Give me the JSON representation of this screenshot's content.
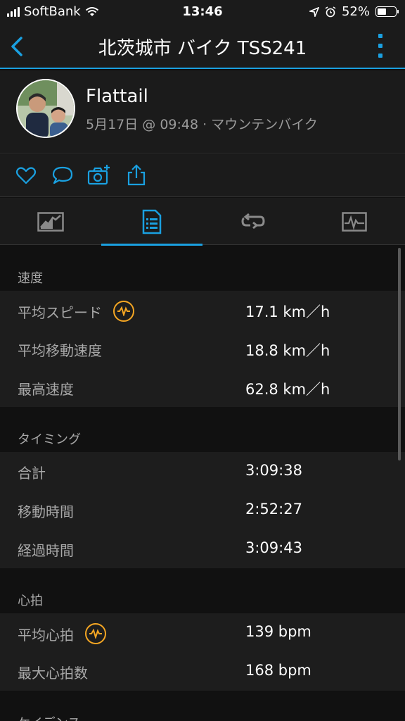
{
  "status_bar": {
    "carrier": "SoftBank",
    "time": "13:46",
    "battery_percent": "52%",
    "battery_level": 0.52
  },
  "navbar": {
    "title": "北茨城市 バイク TSS241",
    "accent_color": "#1aa0e0"
  },
  "profile": {
    "name": "Flattail",
    "meta": "5月17日 @ 09:48 · マウンテンバイク"
  },
  "actions": [
    "heart-icon",
    "comment-icon",
    "camera-add-icon",
    "share-icon"
  ],
  "tabs": [
    {
      "name": "overview-tab",
      "icon": "map-chart-icon",
      "active": false
    },
    {
      "name": "stats-tab",
      "icon": "document-list-icon",
      "active": true
    },
    {
      "name": "laps-tab",
      "icon": "loop-icon",
      "active": false
    },
    {
      "name": "charts-tab",
      "icon": "graph-icon",
      "active": false
    }
  ],
  "sections": {
    "speed": {
      "title": "速度",
      "rows": [
        {
          "label": "平均スピード",
          "value": "17.1 km／h",
          "badge": true
        },
        {
          "label": "平均移動速度",
          "value": "18.8 km／h",
          "badge": false
        },
        {
          "label": "最高速度",
          "value": "62.8 km／h",
          "badge": false
        }
      ]
    },
    "timing": {
      "title": "タイミング",
      "rows": [
        {
          "label": "合計",
          "value": "3:09:38",
          "badge": false
        },
        {
          "label": "移動時間",
          "value": "2:52:27",
          "badge": false
        },
        {
          "label": "経過時間",
          "value": "3:09:43",
          "badge": false
        }
      ]
    },
    "heart_rate": {
      "title": "心拍",
      "rows": [
        {
          "label": "平均心拍",
          "value": "139 bpm",
          "badge": true
        },
        {
          "label": "最大心拍数",
          "value": "168 bpm",
          "badge": false
        }
      ]
    },
    "cadence": {
      "title": "ケイデンス"
    }
  }
}
